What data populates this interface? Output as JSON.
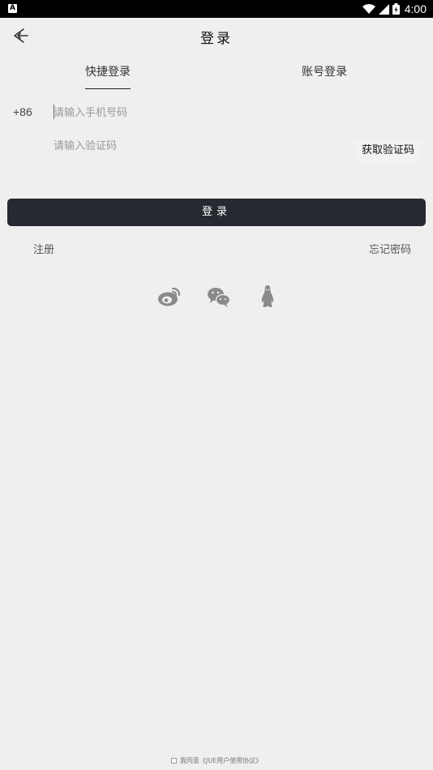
{
  "status_bar": {
    "app_icon": "A",
    "time": "4:00",
    "icons": [
      "wifi-icon",
      "signal-icon",
      "battery-icon"
    ]
  },
  "header": {
    "title": "登录",
    "back_icon": "back-arrow-icon"
  },
  "tabs": [
    {
      "label": "快捷登录",
      "active": true
    },
    {
      "label": "账号登录",
      "active": false
    }
  ],
  "form": {
    "country_code": "+86",
    "phone_placeholder": "请输入手机号码",
    "code_placeholder": "请输入验证码",
    "get_code_label": "获取验证码",
    "login_label": "登录"
  },
  "links": {
    "register": "注册",
    "forgot_password": "忘记密码"
  },
  "social": [
    "weibo-icon",
    "wechat-icon",
    "qq-icon"
  ],
  "agreement": "我同意《JUE用户使用协议》",
  "colors": {
    "background": "#efefef",
    "login_button": "#262930",
    "status_bar": "#000000"
  }
}
